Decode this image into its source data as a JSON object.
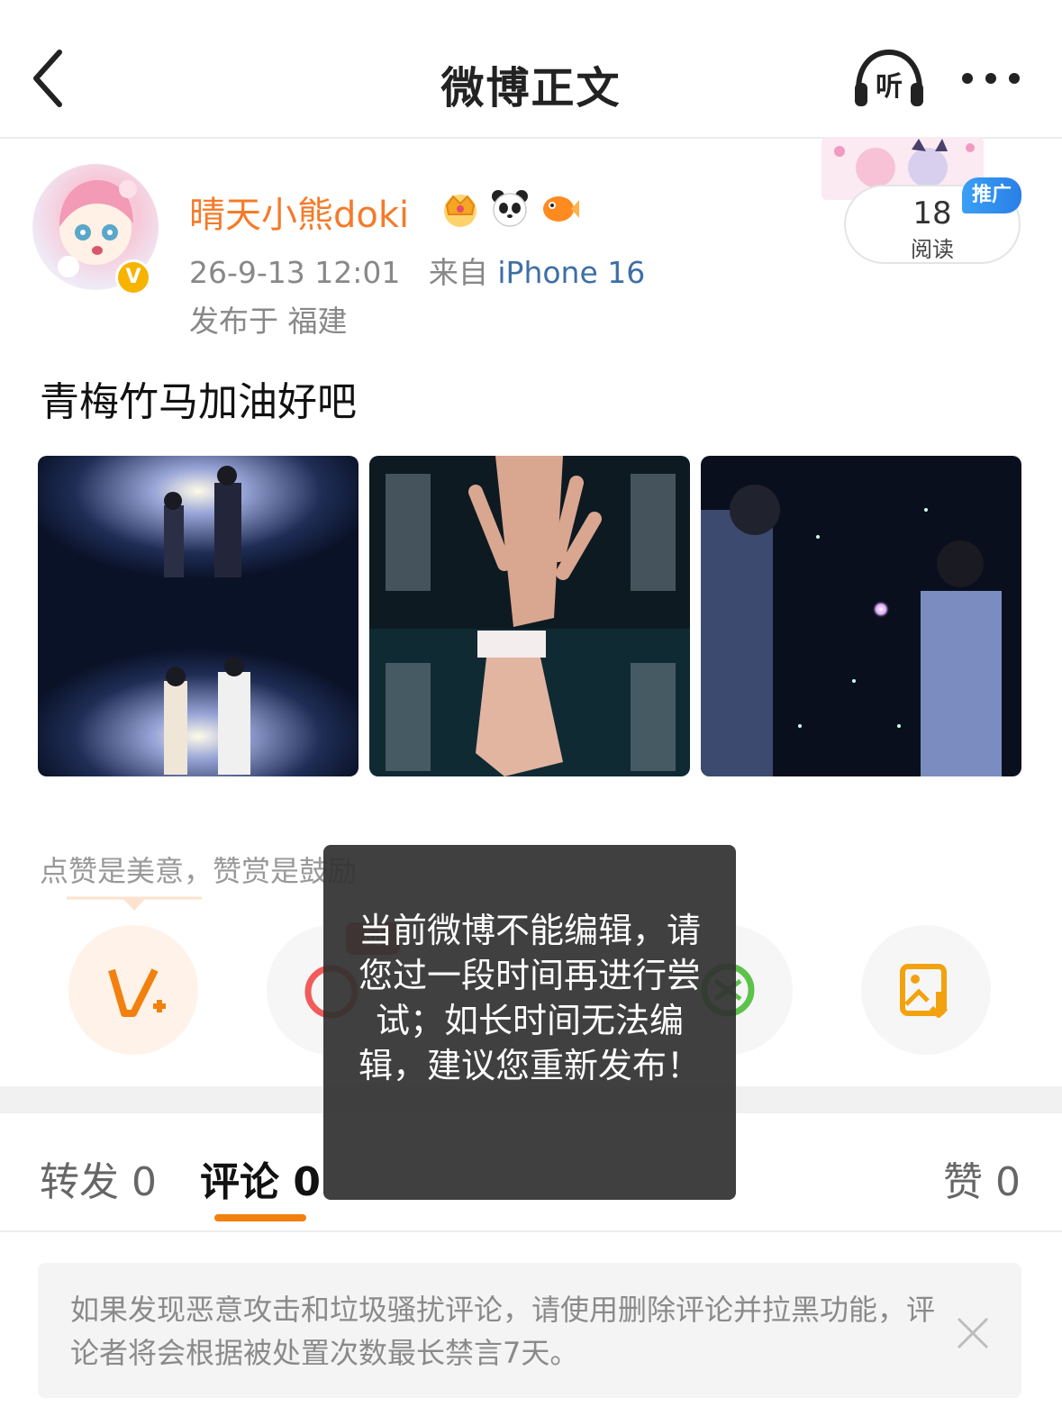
{
  "nav": {
    "title": "微博正文",
    "listen_icon": "listen-headphone-icon",
    "more_icon": "more-dots-icon",
    "back_icon": "back-chevron-icon"
  },
  "author": {
    "name": "晴天小熊doki",
    "verified_icon": "verified-v-icon",
    "badges": [
      "crown-badge-icon",
      "panda-badge-icon",
      "fish-badge-icon"
    ],
    "timestamp": "26-9-13 12:01",
    "source_prefix": "来自",
    "source_device": "iPhone 16",
    "location": "发布于 福建"
  },
  "promo": {
    "read_count": "18",
    "read_label": "阅读",
    "tag": "推广"
  },
  "post": {
    "text": "青梅竹马加油好吧",
    "photos": [
      "photo-couple-light",
      "photo-hands",
      "photo-glowing-hand"
    ]
  },
  "reward": {
    "hint": "点赞是美意，赞赏是鼓励"
  },
  "actions": {
    "ask_tag": "问",
    "items": [
      "vplus-icon",
      "ask-icon",
      "green-icon",
      "save-image-icon"
    ]
  },
  "tabs": {
    "repost": "转发 0",
    "comment": "评论 0",
    "like": "赞 0"
  },
  "notice": {
    "text": "如果发现恶意攻击和垃圾骚扰评论，请使用删除评论并拉黑功能，评论者将会根据被处置次数最长禁言7天。"
  },
  "toast": {
    "text": "当前微博不能编辑，请您过一段时间再进行尝试；如长时间无法编辑，建议您重新发布！"
  },
  "colors": {
    "username": "#f47b2a",
    "device_link": "#3d6fa6",
    "tab_underline": "#f2800f",
    "promo_tag": "#2a7fe6"
  }
}
